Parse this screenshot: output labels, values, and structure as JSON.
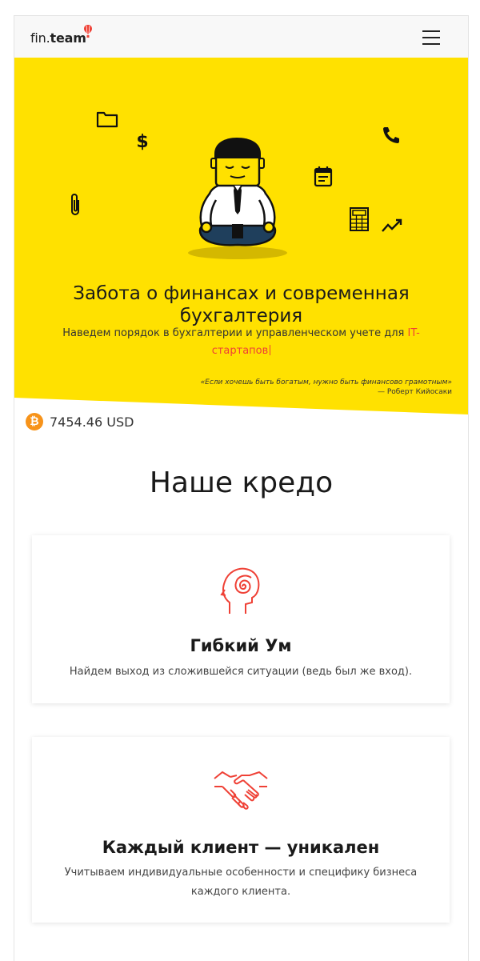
{
  "header": {
    "logo_prefix": "fin.",
    "logo_bold": "team",
    "menu_icon": "hamburger-icon"
  },
  "hero": {
    "title": "Забота о финансах и современная бухгалтерия",
    "subtitle_before": "Наведем порядок в бухгалтерии и управленческом учете для ",
    "subtitle_accent": "IT-стартапов",
    "quote": "«Если хочешь быть богатым, нужно быть финансово грамотным»",
    "quote_author": "— Роберт Кийосаки",
    "background_color": "#ffe100",
    "accent_color": "#ef4136",
    "icons": [
      "folder-icon",
      "dollar-icon",
      "paperclip-icon",
      "phone-icon",
      "calendar-icon",
      "calculator-icon",
      "trend-icon"
    ]
  },
  "ticker": {
    "icon": "bitcoin-icon",
    "symbol": "₿",
    "value": "7454.46 USD"
  },
  "credo": {
    "title": "Наше кредо",
    "cards": [
      {
        "icon": "mind-spiral-icon",
        "title": "Гибкий Ум",
        "text": "Найдем выход из сложившейся ситуации (ведь был же вход)."
      },
      {
        "icon": "handshake-icon",
        "title": "Каждый клиент — уникален",
        "text": "Учитываем индивидуальные особенности и специфику бизнеса каждого клиента."
      }
    ]
  }
}
